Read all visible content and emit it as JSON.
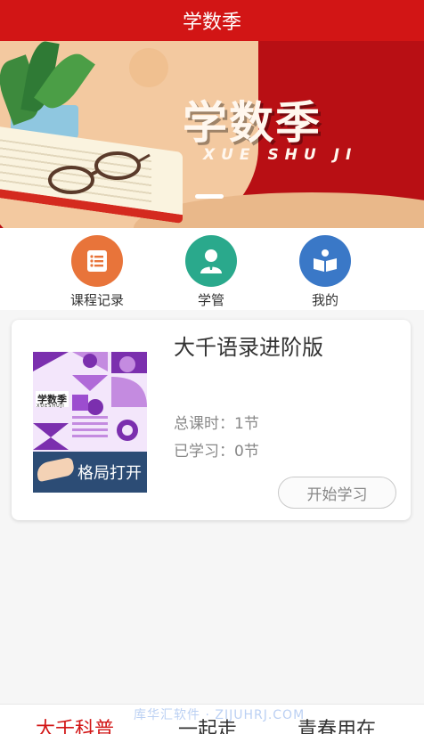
{
  "header": {
    "title": "学数季"
  },
  "banner": {
    "title": "学数季",
    "subtitle": "XUE SHU JI"
  },
  "nav": {
    "items": [
      {
        "label": "课程记录",
        "icon": "list-document-icon",
        "color": "#e8743a"
      },
      {
        "label": "学管",
        "icon": "person-icon",
        "color": "#2aa98c"
      },
      {
        "label": "我的",
        "icon": "open-book-icon",
        "color": "#3a78c7"
      }
    ]
  },
  "course": {
    "title": "大千语录进阶版",
    "total_lessons": "总课时：1节",
    "learned": "已学习：0节",
    "start_label": "开始学习",
    "cover": {
      "logo": "学数季",
      "logo_sub": "XUESHUJI",
      "caption": "格局打开"
    }
  },
  "tabbar": {
    "tabs": [
      {
        "label": "大千科普",
        "active": true
      },
      {
        "label": "一起走",
        "active": false
      },
      {
        "label": "青春用在",
        "active": false
      }
    ]
  },
  "watermark": "库华汇软件 · ZIJUHRJ.COM",
  "colors": {
    "accent": "#d21515",
    "banner_bg": "#b80f14"
  }
}
